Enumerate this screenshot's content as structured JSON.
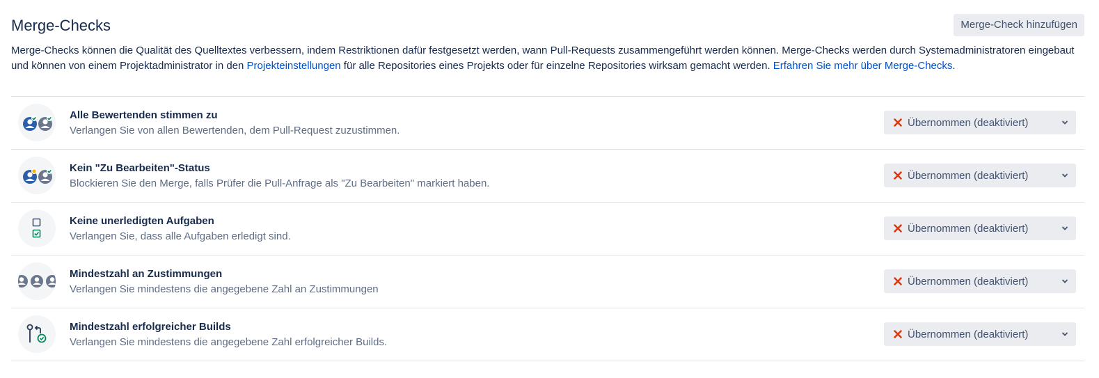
{
  "header": {
    "title": "Merge-Checks",
    "add_button": "Merge-Check hinzufügen"
  },
  "description": {
    "part1": "Merge-Checks können die Qualität des Quelltextes verbessern, indem Restriktionen dafür festgesetzt werden, wann Pull-Requests zusammengeführt werden können. Merge-Checks werden durch Systemadministratoren eingebaut und können von einem Projektadministrator in den ",
    "link1": "Projekteinstellungen",
    "part2": " für alle Repositories eines Projekts oder für einzelne Repositories wirksam gemacht werden. ",
    "link2": "Erfahren Sie mehr über Merge-Checks",
    "part3": "."
  },
  "checks": [
    {
      "icon": "all-reviewers-approve-icon",
      "title": "Alle Bewertenden stimmen zu",
      "description": "Verlangen Sie von allen Bewertenden, dem Pull-Request zuzustimmen.",
      "status": "Übernommen (deaktiviert)"
    },
    {
      "icon": "needs-work-status-icon",
      "title": "Kein \"Zu Bearbeiten\"-Status",
      "description": "Blockieren Sie den Merge, falls Prüfer die Pull-Anfrage als \"Zu Bearbeiten\" markiert haben.",
      "status": "Übernommen (deaktiviert)"
    },
    {
      "icon": "tasks-checklist-icon",
      "title": "Keine unerledigten Aufgaben",
      "description": "Verlangen Sie, dass alle Aufgaben erledigt sind.",
      "status": "Übernommen (deaktiviert)"
    },
    {
      "icon": "minimum-approvals-icon",
      "title": "Mindestzahl an Zustimmungen",
      "description": "Verlangen Sie mindestens die angegebene Zahl an Zustimmungen",
      "status": "Übernommen (deaktiviert)"
    },
    {
      "icon": "successful-builds-icon",
      "title": "Mindestzahl erfolgreicher Builds",
      "description": "Verlangen Sie mindestens die angegebene Zahl erfolgreicher Builds.",
      "status": "Übernommen (deaktiviert)"
    }
  ],
  "colors": {
    "link": "#0052cc",
    "disabled_x": "#de350b",
    "approve_green": "#00875a",
    "needs_work_amber": "#ffab00"
  }
}
